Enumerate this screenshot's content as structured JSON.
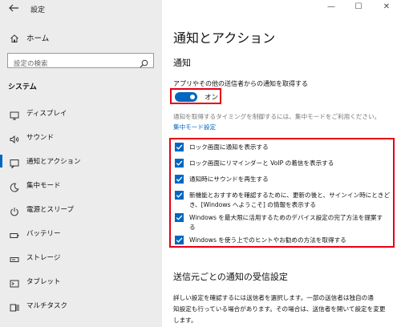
{
  "window": {
    "title": "設定",
    "minimize": "—",
    "maximize": "☐",
    "close": "✕"
  },
  "sidebar": {
    "home_label": "ホーム",
    "search_placeholder": "設定の検索",
    "section_label": "システム",
    "items": [
      {
        "label": "ディスプレイ",
        "icon": "display-icon"
      },
      {
        "label": "サウンド",
        "icon": "speaker-icon"
      },
      {
        "label": "通知とアクション",
        "icon": "notification-icon",
        "selected": true
      },
      {
        "label": "集中モード",
        "icon": "moon-icon"
      },
      {
        "label": "電源とスリープ",
        "icon": "power-icon"
      },
      {
        "label": "バッテリー",
        "icon": "battery-icon"
      },
      {
        "label": "ストレージ",
        "icon": "storage-icon"
      },
      {
        "label": "タブレット",
        "icon": "tablet-icon"
      },
      {
        "label": "マルチタスク",
        "icon": "multitask-icon"
      }
    ]
  },
  "main": {
    "title": "通知とアクション",
    "notify_heading": "通知",
    "toggle_description": "アプリやその他の送信者からの通知を取得する",
    "toggle_state": "オン",
    "toggle_on": true,
    "focus_description": "通知を取得するタイミングを制御するには、集中モードをご利用ください。",
    "focus_link": "集中モード設定",
    "checkboxes": [
      {
        "line1": "ロック画面に通知を表示する",
        "line2": "",
        "checked": true
      },
      {
        "line1": "ロック画面にリマインダーと VoIP の着信を表示する",
        "line2": "",
        "checked": true
      },
      {
        "line1": "通知時にサウンドを再生する",
        "line2": "",
        "checked": true
      },
      {
        "line1": "新機能とおすすめを確認するために、更新の後と、サインイン時にときど",
        "line2": "き、[Windows へようこそ] の情報を表示する",
        "checked": true
      },
      {
        "line1": "Windows を最大限に活用するためのデバイス設定の完了方法を提案す",
        "line2": "る",
        "checked": true
      },
      {
        "line1": "Windows を使う上でのヒントやお勧めの方法を取得する",
        "line2": "",
        "checked": true
      }
    ],
    "sender_heading": "送信元ごとの通知の受信設定",
    "sender_desc_line1": "詳しい設定を確認するには送信者を選択します。一部の送信者は独自の通",
    "sender_desc_line2": "知設定も行っている場合があります。その場合は、送信者を開いて設定を変更",
    "sender_desc_line3": "します。"
  },
  "colors": {
    "accent": "#0067c0",
    "highlight_border": "#e60012",
    "sidebar_bg": "#ececec"
  }
}
